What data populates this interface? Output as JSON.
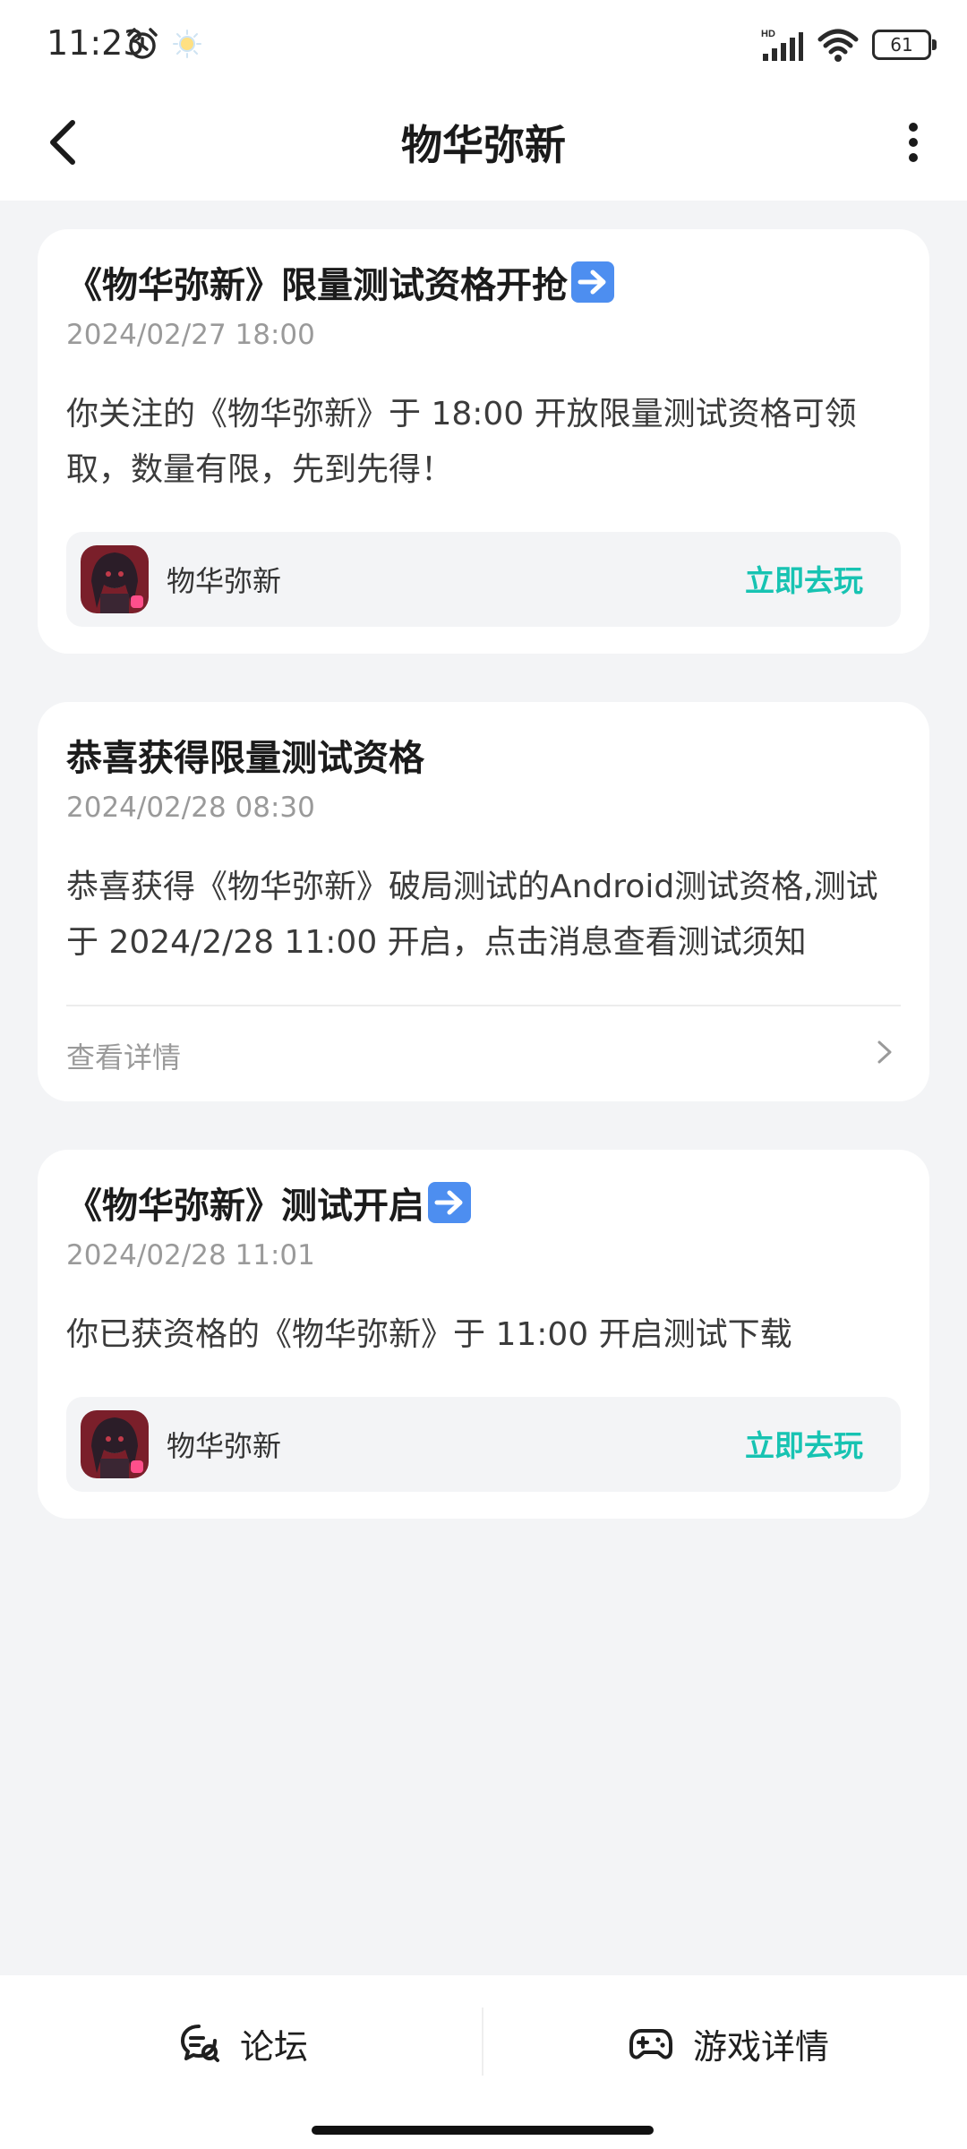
{
  "status_bar": {
    "time": "11:23",
    "network": "HD",
    "battery": "61"
  },
  "header": {
    "title": "物华弥新"
  },
  "messages": [
    {
      "title": "《物华弥新》限量测试资格开抢",
      "date": "2024/02/27 18:00",
      "body": "你关注的《物华弥新》于 18:00 开放限量测试资格可领取，数量有限，先到先得！",
      "game_name": "物华弥新",
      "action_label": "立即去玩"
    },
    {
      "title": "恭喜获得限量测试资格",
      "date": "2024/02/28 08:30",
      "body": "恭喜获得《物华弥新》破局测试的Android测试资格,测试于 2024/2/28 11:00 开启，点击消息查看测试须知",
      "detail_label": "查看详情"
    },
    {
      "title": "《物华弥新》测试开启",
      "date": "2024/02/28 11:01",
      "body": "你已获资格的《物华弥新》于 11:00 开启测试下载",
      "game_name": "物华弥新",
      "action_label": "立即去玩"
    }
  ],
  "bottom_tabs": [
    {
      "label": "论坛",
      "icon": "forum-chat-icon"
    },
    {
      "label": "游戏详情",
      "icon": "gamepad-icon"
    }
  ],
  "colors": {
    "accent": "#17c3b2",
    "background": "#f3f4f6",
    "card": "#ffffff"
  }
}
